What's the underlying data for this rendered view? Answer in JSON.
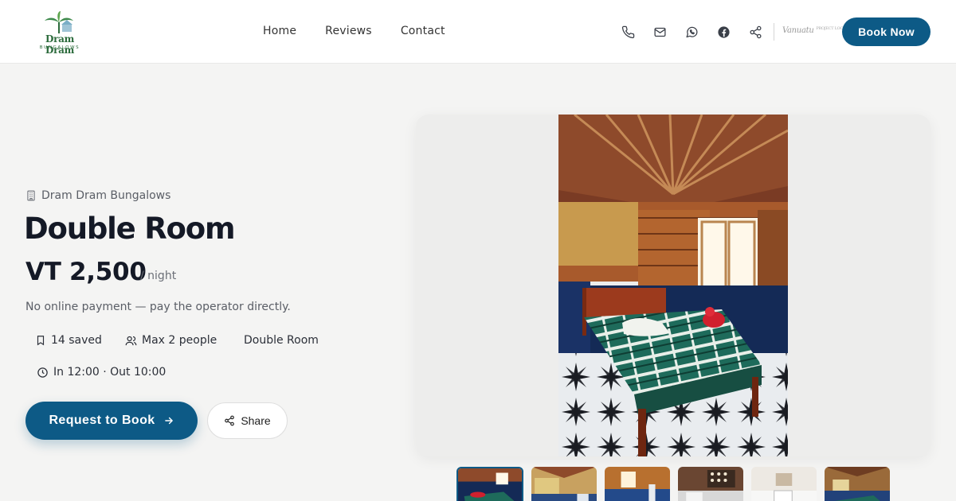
{
  "brand": {
    "name": "Dram Dram",
    "sub": "BUNGALOWS"
  },
  "nav": {
    "home": "Home",
    "reviews": "Reviews",
    "contact": "Contact"
  },
  "header_icons": [
    "phone-icon",
    "mail-icon",
    "whatsapp-icon",
    "facebook-icon",
    "share-icon"
  ],
  "partner": {
    "name": "Vanuatu",
    "tag": "PROJECT LOCAL"
  },
  "book_now": "Book Now",
  "listing": {
    "operator": "Dram Dram Bungalows",
    "title": "Double Room",
    "price": "VT 2,500",
    "per": "/ night",
    "note": "No online payment — pay the operator directly.",
    "saved": "14 saved",
    "capacity": "Max 2 people",
    "room_type": "Double Room",
    "checkin": "In 12:00 · Out 10:00"
  },
  "actions": {
    "request": "Request to Book",
    "share": "Share"
  },
  "colors": {
    "accent": "#0d5a86",
    "brand_green": "#2c6b3c"
  },
  "gallery": {
    "thumbnail_count": 6,
    "active_index": 0
  }
}
